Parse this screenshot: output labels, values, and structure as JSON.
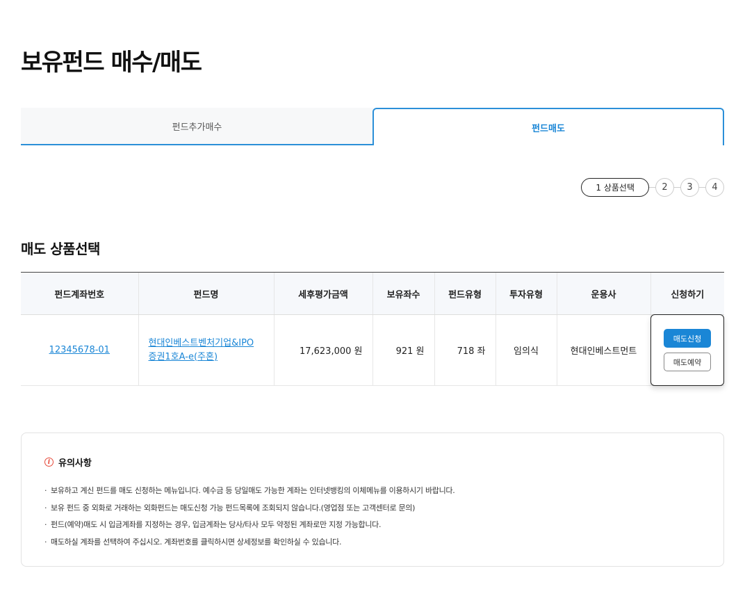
{
  "page": {
    "title": "보유펀드 매수/매도"
  },
  "tabs": [
    {
      "label": "펀드추가매수",
      "active": false
    },
    {
      "label": "펀드매도",
      "active": true
    }
  ],
  "stepper": {
    "current": "1 상품선택",
    "steps": [
      "2",
      "3",
      "4"
    ]
  },
  "section": {
    "title": "매도 상품선택"
  },
  "table": {
    "headers": [
      "펀드계좌번호",
      "펀드명",
      "세후평가금액",
      "보유좌수",
      "펀드유형",
      "투자유형",
      "운용사",
      "신청하기"
    ],
    "rows": [
      {
        "account": "12345678-01",
        "fund_name_line1": "현대인베스트벤처기업&IPO",
        "fund_name_line2": "증권1호A-e(주혼)",
        "after_tax_value": "17,623,000 원",
        "holding_units": "921 원",
        "fund_type": "718 좌",
        "invest_type": "임의식",
        "manager": "현대인베스트먼트"
      }
    ],
    "actions": {
      "sell_request": "매도신청",
      "sell_reserve": "매도예약"
    }
  },
  "notice": {
    "title": "유의사항",
    "items": [
      "보유하고 계신 펀드를 매도 신청하는 메뉴입니다. 예수금 등 당일매도 가능한 계좌는 인터넷뱅킹의 이체메뉴를 이용하시기 바랍니다.",
      "보유 펀드 중 외화로 거래하는 외화펀드는 매도신청 가능 펀드목록에 조회되지 않습니다.(영업점 또는 고객센터로 문의)",
      "펀드(예약)매도 시 입금계좌를 지정하는 경우, 입금계좌는 당사/타사 모두 약정된 계좌로만 지정 가능합니다.",
      "매도하실 계좌를 선택하여 주십시오. 계좌번호를 클릭하시면 상세정보를 확인하실 수 있습니다."
    ]
  },
  "colors": {
    "accent": "#1a86d6",
    "warning": "#e64a3b"
  }
}
